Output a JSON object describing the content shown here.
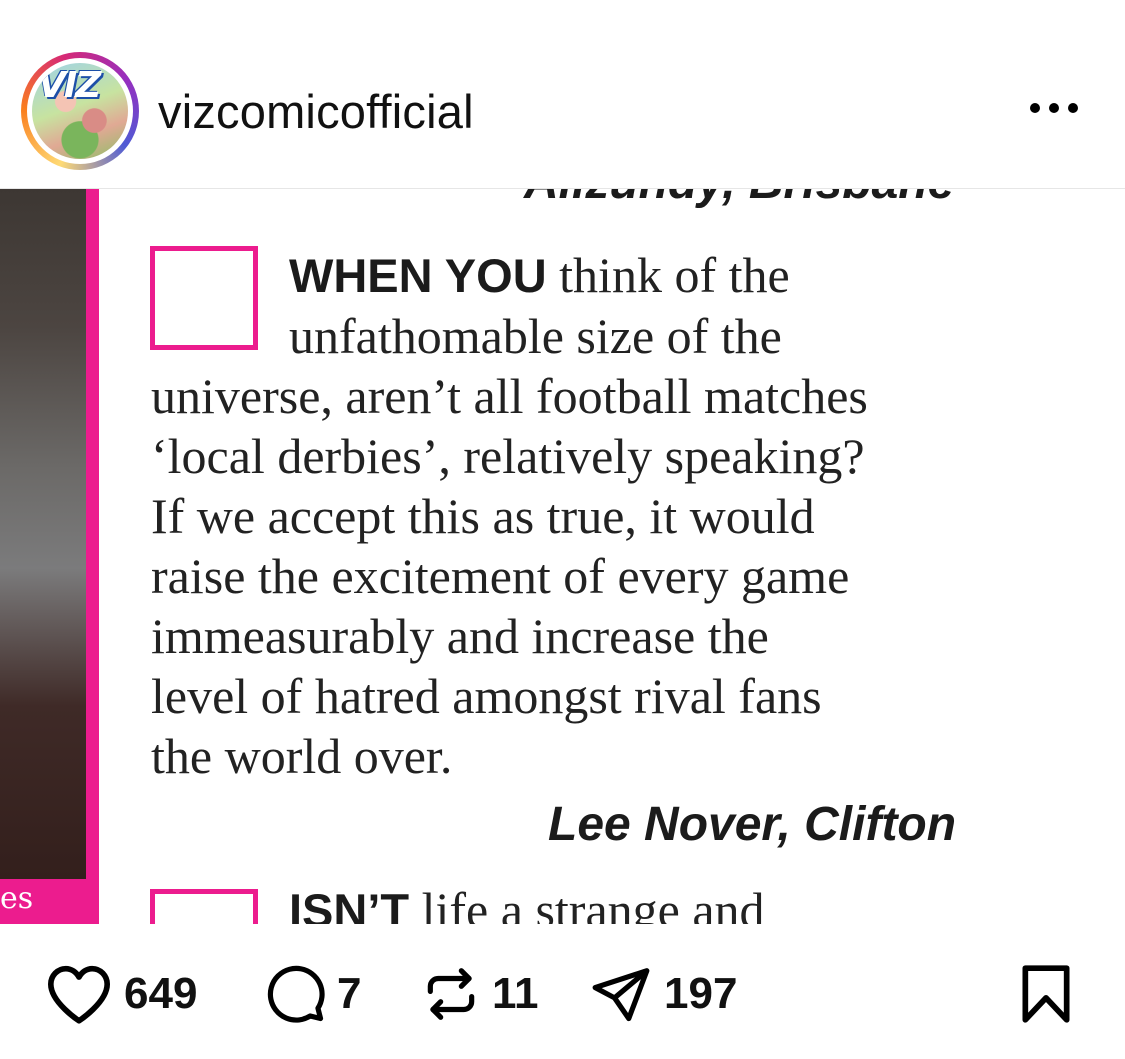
{
  "header": {
    "username": "vizcomicofficial",
    "avatar_logo": "VIZ",
    "more_icon": "more-horizontal-icon"
  },
  "post": {
    "previous_signature": "Alizundy, Brisbane",
    "letter_lead": "WHEN YOU",
    "letter_lines": [
      "think of the",
      "unfathomable size of the",
      "universe, aren’t all football matches",
      "‘local derbies’, relatively speaking?",
      "If we accept this as true, it would",
      "raise the excitement of every game",
      "immeasurably and increase the",
      "level of hatred amongst rival fans",
      "the world over."
    ],
    "signature": "Lee Nover, Clifton",
    "next_lead": "ISN’T",
    "next_text": "life a strange and",
    "photo_caption": "es",
    "accent_color": "#ec1c8e"
  },
  "actions": {
    "likes": "649",
    "comments": "7",
    "reposts": "11",
    "shares": "197",
    "icons": [
      "heart-icon",
      "comment-icon",
      "repost-icon",
      "send-icon",
      "bookmark-icon"
    ]
  }
}
